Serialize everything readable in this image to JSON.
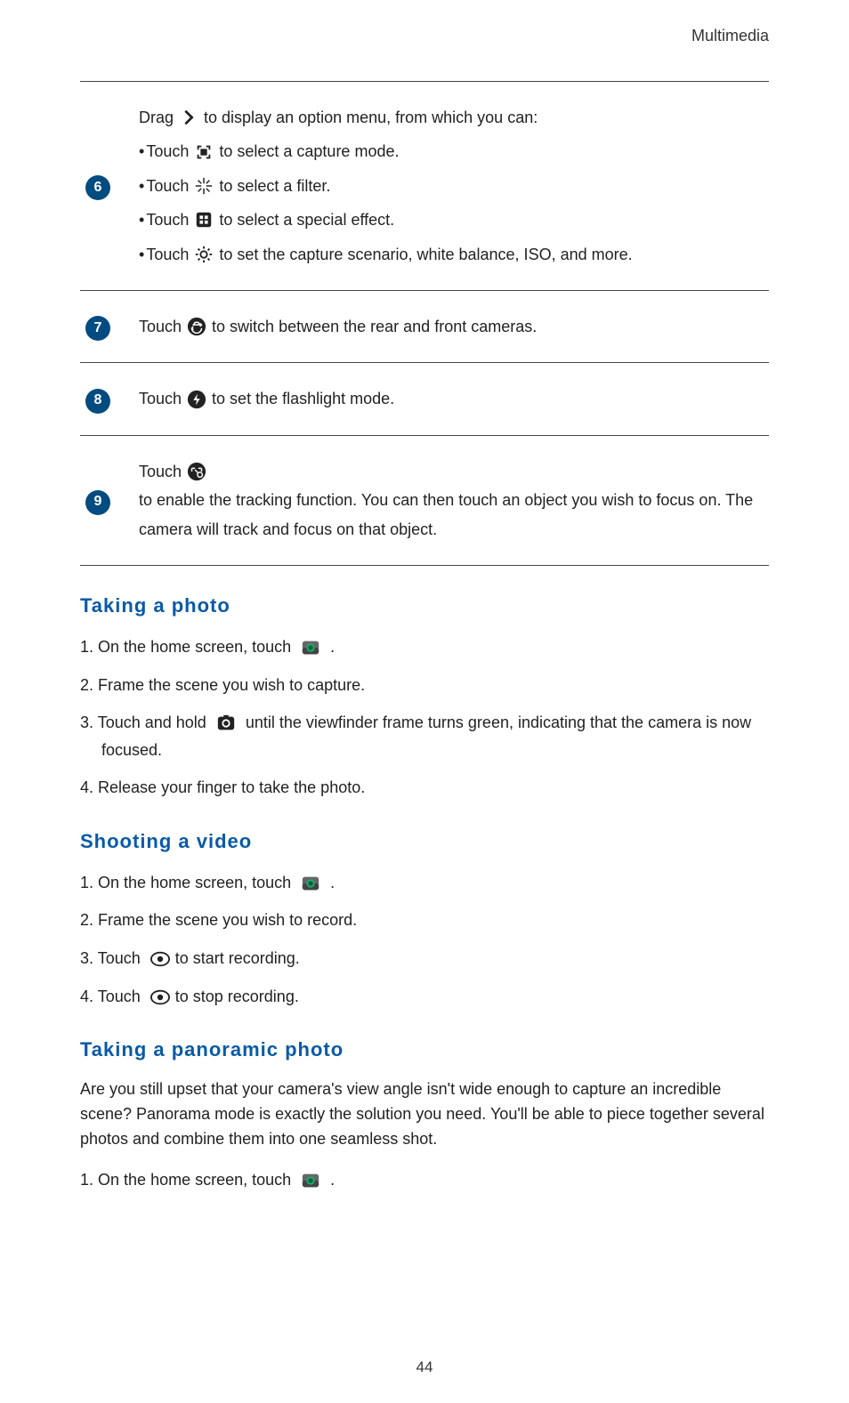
{
  "header": {
    "section": "Multimedia"
  },
  "table_rows": [
    {
      "num": "6",
      "lines": [
        {
          "pre": "Drag ",
          "icon": "chevron-right-icon",
          "post": " to display an option menu, from which you can:"
        },
        {
          "bullet": true,
          "pre": "Touch ",
          "icon": "capture-mode-icon",
          "post": "to select a capture mode."
        },
        {
          "bullet": true,
          "pre": "Touch ",
          "icon": "filter-icon",
          "post": " to select a filter."
        },
        {
          "bullet": true,
          "pre": "Touch ",
          "icon": "effect-icon",
          "post": " to select a special effect."
        },
        {
          "bullet": true,
          "pre": "Touch ",
          "icon": "gear-icon",
          "post": " to set the capture scenario, white balance, ISO, and more."
        }
      ]
    },
    {
      "num": "7",
      "lines": [
        {
          "pre": "Touch ",
          "icon": "switch-camera-icon",
          "post": " to switch between the rear and front cameras."
        }
      ]
    },
    {
      "num": "8",
      "lines": [
        {
          "pre": "Touch ",
          "icon": "flash-icon",
          "post": " to set the flashlight mode."
        }
      ]
    },
    {
      "num": "9",
      "lines": [
        {
          "pre": "Touch ",
          "icon": "tracking-icon",
          "post": " to enable the tracking function. You can then touch an object you wish to focus on. The camera will track and focus on that object."
        }
      ]
    }
  ],
  "sections": [
    {
      "title": "Taking a photo",
      "steps": [
        {
          "pre": "On the home screen, touch ",
          "icon": "camera-app-icon",
          "post": " ."
        },
        {
          "pre": "Frame the scene you wish to capture."
        },
        {
          "pre": "Touch and hold ",
          "icon": "shutter-icon",
          "post": " until the viewfinder frame turns green, indicating that the camera is now focused."
        },
        {
          "pre": "Release your finger to take the photo."
        }
      ]
    },
    {
      "title": "Shooting a video",
      "steps": [
        {
          "pre": "On the home screen, touch ",
          "icon": "camera-app-icon",
          "post": " ."
        },
        {
          "pre": "Frame the scene you wish to record."
        },
        {
          "pre": "Touch ",
          "icon": "record-icon",
          "post": "to start recording."
        },
        {
          "pre": "Touch ",
          "icon": "record-icon",
          "post": "to stop recording."
        }
      ]
    },
    {
      "title": "Taking a panoramic photo",
      "intro": "Are you still upset that your camera's view angle isn't wide enough to capture an incredible scene? Panorama mode is exactly the solution you need. You'll be able to piece together several photos and combine them into one seamless shot.",
      "steps": [
        {
          "pre": "On the home screen, touch ",
          "icon": "camera-app-icon",
          "post": " ."
        }
      ]
    }
  ],
  "page_number": "44"
}
